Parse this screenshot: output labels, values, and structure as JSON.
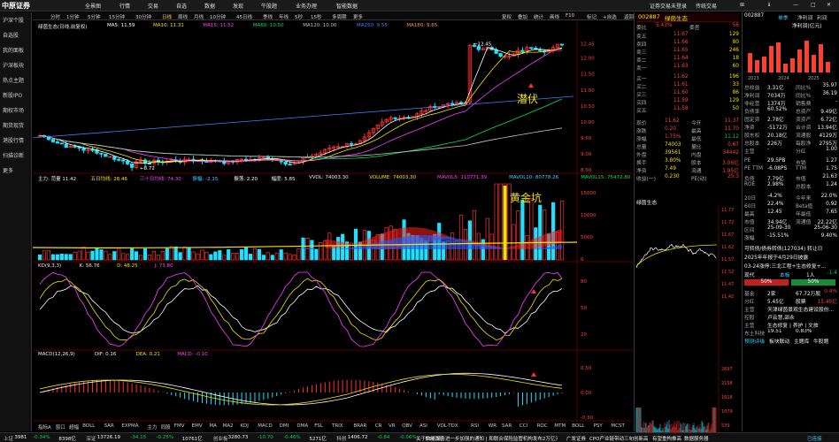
{
  "menubar": {
    "logo": "中原证券",
    "items": [
      "全景图",
      "行情",
      "交易",
      "自选",
      "数据",
      "发现",
      "牛股题",
      "业务办理",
      "智能数据"
    ],
    "right": [
      "证券交易未登录",
      "传统交易",
      "⊞",
      "ℹ",
      "—",
      "□",
      "✕"
    ]
  },
  "sidebar": [
    "沪深个股",
    "自选股",
    "我的面板",
    "沪深板块",
    "热点主题",
    "新股IPO",
    "期权市场",
    "期货现货",
    "港股行情",
    "扫描诊断",
    "更多"
  ],
  "toolbar": {
    "periods": [
      "分时",
      "1分钟",
      "5分钟",
      "15分钟",
      "30分钟",
      "日线",
      "周线",
      "月线",
      "10分钟",
      "45日线",
      "季线",
      "年线",
      "5秒",
      "15秒",
      "多周期",
      "更多"
    ],
    "active": "日线",
    "right": [
      "复权",
      "叠加",
      "统计",
      "画线",
      "F10",
      "标记",
      "+自选",
      "返回"
    ]
  },
  "main_chart": {
    "title": "绿茵生态(日线,前复权)",
    "ma": [
      {
        "label": "MA5: 11.59",
        "color": "#ffffff"
      },
      {
        "label": "MA10: 11.31",
        "color": "#f2e200"
      },
      {
        "label": "MA15: 11.52",
        "color": "#ff40ff"
      },
      {
        "label": "MA60: 10.50",
        "color": "#00e060"
      },
      {
        "label": "MA120: 10.00",
        "color": "#c0c0c0"
      },
      {
        "label": "MA250: 9.55",
        "color": "#4080ff"
      },
      {
        "label": "MA180: 9.65",
        "color": "#ff9933"
      }
    ],
    "high_mark": "12.45",
    "low_mark": "8.72",
    "annotation": "潜伏",
    "y_ticks": [
      "12.45",
      "12.00",
      "11.50",
      "11.00",
      "10.50",
      "10.00",
      "9.50",
      "9.00",
      "8.50"
    ]
  },
  "vol_chart": {
    "labels": [
      {
        "text": "主力: 范量 11.42",
        "color": "#eeeeee"
      },
      {
        "text": "五日均线: 28.46",
        "color": "#f2e200"
      },
      {
        "text": "三十日均线: 74.30",
        "color": "#ff40ff"
      },
      {
        "text": "振幅: -2.15",
        "color": "#3cd0ff"
      },
      {
        "text": "振荡: 2.20",
        "color": "#ffffff"
      },
      {
        "text": "幅度: 5.85",
        "color": "#eeeeee"
      },
      {
        "text": "VVOL: 74003.30",
        "color": "#eeeeee"
      },
      {
        "text": "VOLUME: 74003.30",
        "color": "#f2e200"
      },
      {
        "text": "MAVOL5: 110771.39",
        "color": "#ff40ff"
      },
      {
        "text": "MAVOL10: 80778.26",
        "color": "#3cd0ff"
      },
      {
        "text": "MAVOL15: 75472.80",
        "color": "#00e060"
      }
    ],
    "annotation": "黄金坑",
    "y_ticks": [
      "15000",
      "10000",
      "5000",
      "0"
    ]
  },
  "kdj": {
    "labels": [
      {
        "text": "KD(9,3,3)",
        "color": "#eeeeee"
      },
      {
        "text": "K: 56.76",
        "color": "#eeeeee"
      },
      {
        "text": "D: 48.25",
        "color": "#f2e200"
      },
      {
        "text": "J: 73.80",
        "color": "#ff40ff"
      }
    ],
    "y_ticks": [
      "80",
      "50",
      "20"
    ]
  },
  "macd": {
    "labels": [
      {
        "text": "MACD(12,26,9)",
        "color": "#eeeeee"
      },
      {
        "text": "DIF: 0.16",
        "color": "#eeeeee"
      },
      {
        "text": "DEA: 0.21",
        "color": "#f2e200"
      },
      {
        "text": "MACD: -0.10",
        "color": "#ff40ff"
      }
    ],
    "y_ticks": [
      "0.50",
      "0.00",
      "-0.50"
    ]
  },
  "indicator_tabs": [
    "指标A",
    "窗口",
    "超幅",
    "BOLL",
    "SAR",
    "EXPMA",
    "主力",
    "同股",
    "FMV",
    "EMV",
    "MA",
    "MA2",
    "KDJ",
    "MACD",
    "DMI",
    "DMA",
    "FSL",
    "TRIX",
    "BRAR",
    "CR",
    "VR",
    "OBV",
    "ASI",
    "VOL-TDX",
    "RSI",
    "WR",
    "SAR",
    "CCI",
    "ROC",
    "MTM",
    "BOLL",
    "PSY",
    "MCST",
    "龙线",
    "筹码",
    "更多"
  ],
  "quote": {
    "code": "002887",
    "name": "绿茵生态",
    "weibi_label": "委比",
    "weibi": "5.43%",
    "weicha_label": "委差",
    "weicha": "56",
    "asks": [
      [
        "卖五",
        "11.67",
        "129"
      ],
      [
        "卖四",
        "11.66",
        "80"
      ],
      [
        "卖三",
        "11.65",
        "246"
      ],
      [
        "卖二",
        "11.64",
        "18"
      ],
      [
        "卖一",
        "11.63",
        "60"
      ]
    ],
    "bids": [
      [
        "买一",
        "11.62",
        "196"
      ],
      [
        "买二",
        "11.61",
        "33"
      ],
      [
        "买三",
        "11.60",
        "86"
      ],
      [
        "买四",
        "11.59",
        "129"
      ],
      [
        "买五",
        "11.58",
        "50"
      ]
    ],
    "stats": [
      [
        "现价",
        "11.62",
        "今开",
        "11.37"
      ],
      [
        "涨跌",
        "0.20",
        "最高",
        "11.70"
      ],
      [
        "涨幅",
        "1.75%",
        "最低",
        "11.12"
      ],
      [
        "总量",
        "74003",
        "量比",
        "0.67"
      ],
      [
        "外盘",
        "39561",
        "内盘",
        "34442"
      ],
      [
        "换手",
        "3.80%",
        "股本",
        "3.06亿"
      ],
      [
        "净资",
        "7.49",
        "流通",
        "1.95亿"
      ],
      [
        "收益(一)",
        "0.230",
        "PE(动)",
        "25.3"
      ]
    ],
    "intraday_title": "绿茵生态",
    "intraday_ticks": [
      "11.77",
      "11.72",
      "11.67",
      "11.62",
      "11.57",
      "11.52",
      "11.47",
      "11.42"
    ],
    "intraday_vol_ticks": [
      "2697",
      "2158",
      "1618",
      "1079",
      "539"
    ]
  },
  "fundamentals": {
    "code": "002887",
    "tabs": [
      "单季",
      "净利润",
      "利润"
    ],
    "chart_title": "净利润(亿元)",
    "years": [
      "2023",
      "2024",
      "2025"
    ],
    "items": [
      [
        "总收益",
        "3.31亿",
        "同比%",
        "35.97"
      ],
      [
        "净利润",
        "7034万",
        "同比%",
        "36.19"
      ],
      [
        "非经营",
        "1374万",
        "销售费",
        "-"
      ],
      [
        "负债率",
        "60.52%",
        "总资产",
        "9.49亿"
      ],
      [
        "固定资",
        "2.78亿",
        "流资产",
        "6.72亿"
      ],
      [
        "净资",
        "-5172万",
        "合计资",
        "13.94亿"
      ],
      [
        "股东权",
        "20.18亿",
        "流通股",
        "4129万"
      ],
      [
        "总股本",
        "226万",
        "每股净",
        "2795万"
      ],
      [
        "主营",
        "-",
        "分红",
        "1.00"
      ]
    ],
    "valuation": [
      [
        "PE",
        "29.5PB",
        "市销",
        "1.27"
      ],
      [
        "PE TTM",
        "-6.08PS",
        "TTM",
        "1.75"
      ],
      [
        "负债",
        "7.79亿",
        "市值",
        "21.63"
      ],
      [
        "ROE",
        "2.98%",
        "总股本",
        "1.24"
      ]
    ],
    "perf": [
      [
        "20日",
        "-4.2%",
        "今年来",
        "22.0%"
      ],
      [
        "60日",
        "22.4%",
        "Beta值",
        "0.92"
      ],
      [
        "最高",
        "12.45",
        "年最低",
        "7.65"
      ],
      [
        "市值",
        "34.94亿",
        "流通值",
        "22.22亿"
      ],
      [
        "区间",
        "25-09-30",
        "",
        "25-06-30"
      ],
      [
        "涨幅",
        "-15.51%",
        "",
        "9.40%"
      ]
    ],
    "news": [
      "可转债/债券转债(127034) 转让日",
      "2025年年报于4月29日披露",
      "03-24涨停:三北工程+生态修复+..."
    ],
    "quote_board": {
      "title": "现代",
      "board": "本板",
      "value": "1人",
      "change": "-1.4"
    },
    "bars": [
      {
        "label": "50%",
        "kind": "red"
      },
      {
        "label": "50%",
        "kind": "green"
      }
    ],
    "tail": [
      [
        "基金",
        "2家",
        "67.72万股",
        "0.4%"
      ],
      [
        "分红",
        "5.45亿",
        "股票",
        "15.45亿"
      ],
      [
        "主营",
        "天津绿茵景观生态建设股份..."
      ],
      [
        "控股",
        "卢云慧,邵永"
      ],
      [
        "主营",
        "生态修复 | 养护 | 文旅"
      ],
      [
        "东土科技",
        "19.51",
        "0.83%"
      ]
    ],
    "bottom_tabs": [
      "预测评级",
      "板块联动",
      "主题库",
      "牛股题"
    ]
  },
  "bottom_bar": {
    "items": [
      [
        "上证",
        "3981",
        "-0.34%",
        "8398亿"
      ],
      [
        "深证",
        "13726.19",
        "-34.15",
        "-0.25%",
        "10761亿"
      ],
      [
        "创业板",
        "3280.73",
        "-10.70",
        "-0.46%",
        "5271亿"
      ],
      [
        "科创",
        "1406.72",
        "-0.84",
        "-0.06%",
        "534.3亿"
      ]
    ],
    "ticker": "关于数据服务进一步加强的通知 | 和联合保险监管机构发布2万亿元市场风险",
    "right": [
      "广发证券",
      "CPO产业链带动三旬创新高",
      "有望重构推高",
      "数据服务器"
    ],
    "status": "已连接"
  }
}
